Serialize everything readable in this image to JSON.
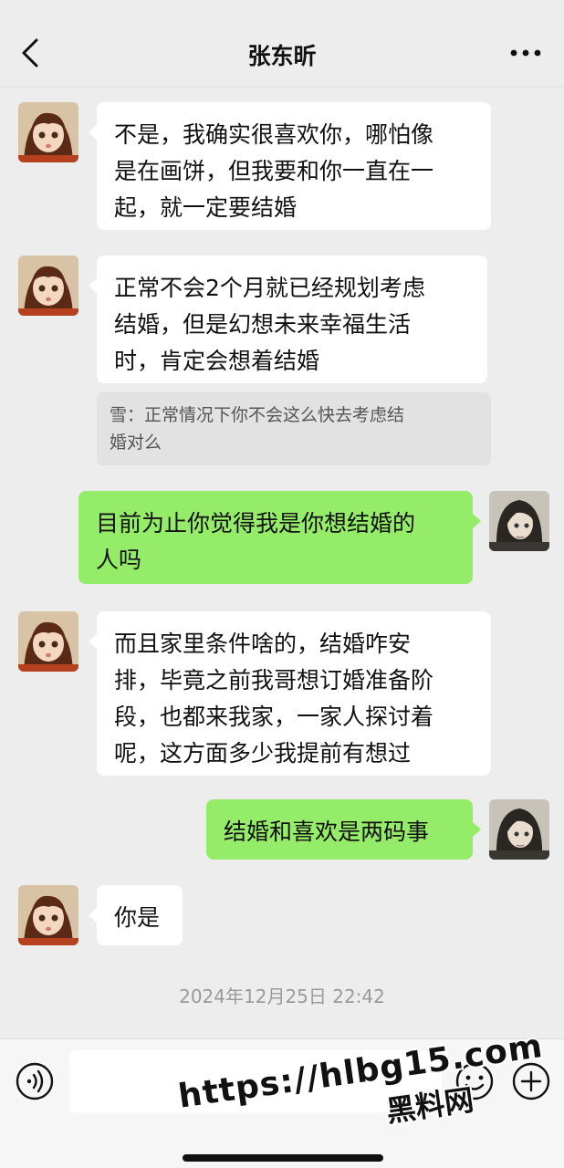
{
  "header": {
    "title": "张东昕",
    "back_icon": "chevron-left-icon",
    "more_icon": "more-dots-icon"
  },
  "messages": [
    {
      "direction": "in",
      "lines": [
        "不是，我确实很喜欢你，哪怕像",
        "是在画饼，但我要和你一直在一",
        "起，就一定要结婚"
      ]
    },
    {
      "direction": "in",
      "lines": [
        "正常不会2个月就已经规划考虑",
        "结婚，但是幻想未来幸福生活",
        "时，肯定会想着结婚"
      ]
    },
    {
      "direction": "out",
      "lines": [
        "目前为止你觉得我是你想结婚的",
        "人吗"
      ]
    },
    {
      "direction": "in",
      "lines": [
        "而且家里条件啥的，结婚咋安",
        "排，毕竟之前我哥想订婚准备阶",
        "段，也都来我家，一家人探讨着",
        "呢，这方面多少我提前有想过"
      ]
    },
    {
      "direction": "out",
      "lines": [
        "结婚和喜欢是两码事"
      ]
    },
    {
      "direction": "in",
      "lines": [
        "你是"
      ]
    }
  ],
  "quote": {
    "lines": [
      "雪：正常情况下你不会这么快去考虑结",
      "婚对么"
    ]
  },
  "timestamp": "2024年12月25日 22:42",
  "input_bar": {
    "voice_icon": "voice-icon",
    "emoji_icon": "emoji-icon",
    "plus_icon": "plus-icon"
  },
  "watermark": {
    "line1": "https://hlbg15.com",
    "line2": "黑料网"
  },
  "colors": {
    "background": "#ededed",
    "incoming_bubble": "#ffffff",
    "outgoing_bubble": "#95ec69",
    "quote_bg": "#e2e2e2"
  }
}
